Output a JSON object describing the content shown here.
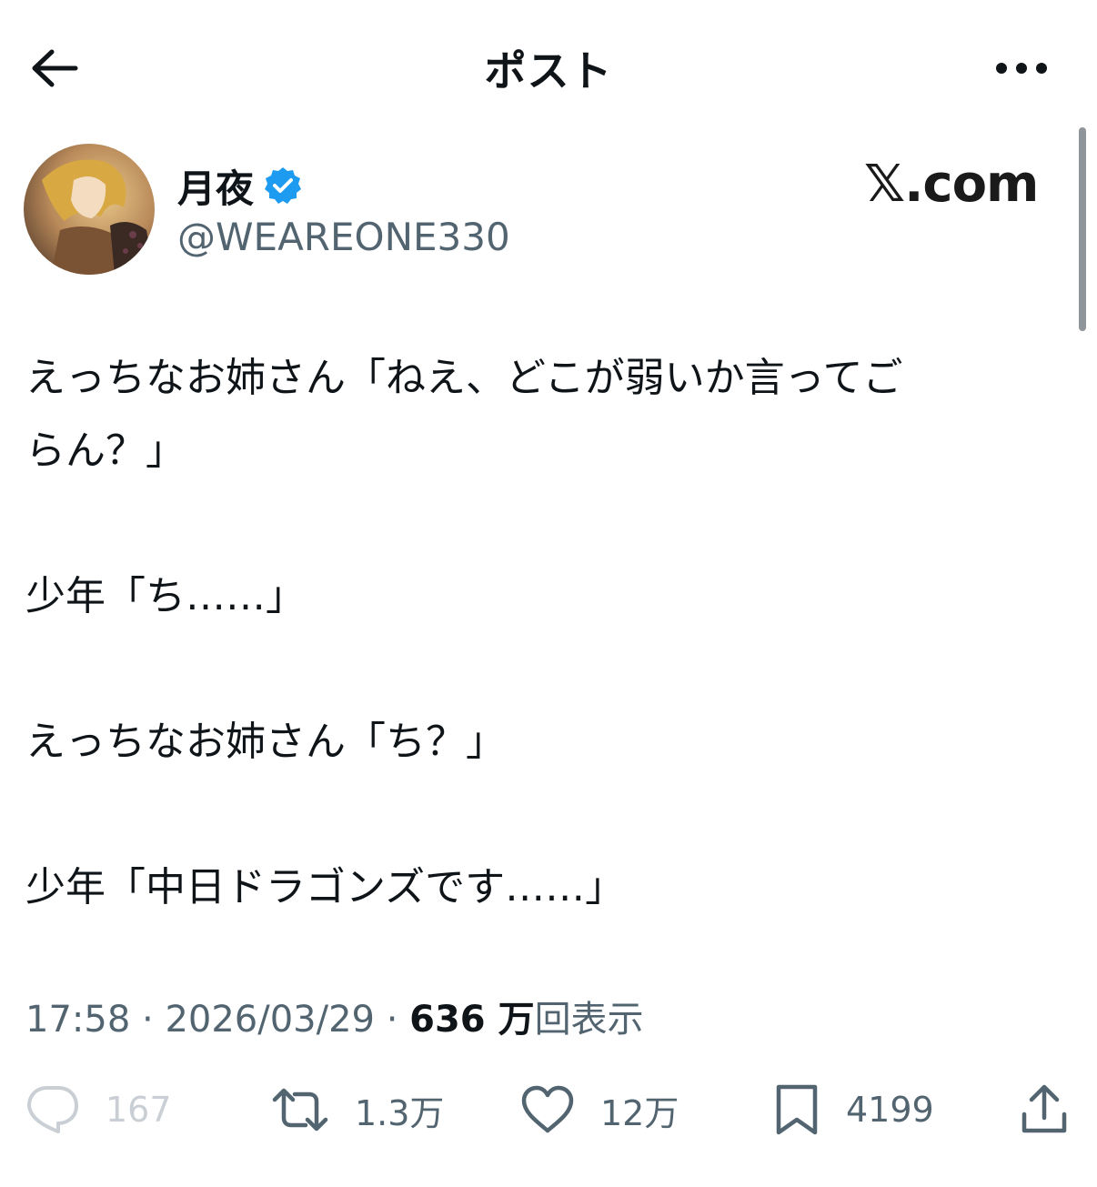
{
  "header": {
    "title": "ポスト",
    "back_icon": "arrow-left-icon",
    "more_icon": "more-horizontal-icon"
  },
  "author": {
    "display_name": "月夜",
    "handle": "@WEAREONE330",
    "verified": true,
    "verified_color": "#1d9bf0"
  },
  "watermark": "𝕏.com",
  "post": {
    "lines": [
      "えっちなお姉さん「ねえ、どこが弱いか言ってご",
      "らん？」",
      "",
      "少年「ち……」",
      "",
      "えっちなお姉さん「ち？」",
      "",
      "少年「中日ドラゴンズです……」"
    ]
  },
  "meta": {
    "time": "17:58",
    "separator": "·",
    "date": "2026/03/29",
    "views_count": "636 万",
    "views_label": "回表示"
  },
  "actions": {
    "reply": {
      "icon": "reply-icon",
      "count": "167"
    },
    "repost": {
      "icon": "repost-icon",
      "count": "1.3万"
    },
    "like": {
      "icon": "heart-icon",
      "count": "12万"
    },
    "bookmark": {
      "icon": "bookmark-icon",
      "count": "4199"
    },
    "share": {
      "icon": "share-icon"
    }
  },
  "colors": {
    "text_primary": "#0f1419",
    "text_secondary": "#536471",
    "accent": "#1d9bf0"
  }
}
